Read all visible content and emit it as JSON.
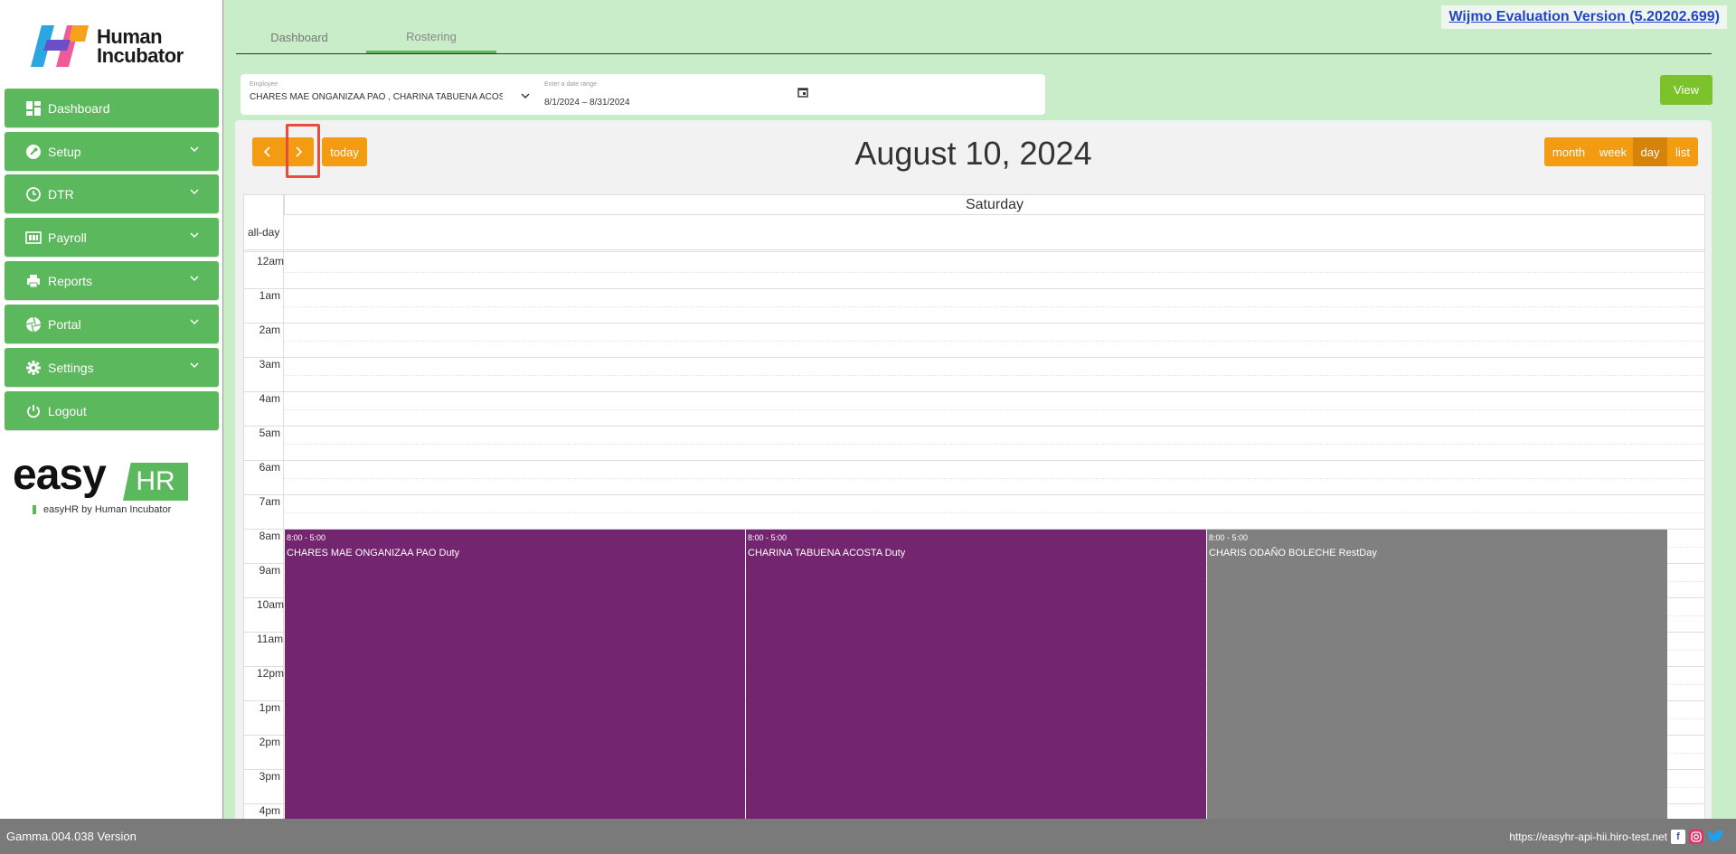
{
  "brand": {
    "line1": "Human",
    "line2": "Incubator"
  },
  "sidebar": {
    "items": [
      {
        "label": "Dashboard",
        "icon": "dashboard-icon"
      },
      {
        "label": "Setup",
        "icon": "wrench-icon"
      },
      {
        "label": "DTR",
        "icon": "clock-icon"
      },
      {
        "label": "Payroll",
        "icon": "payroll-icon"
      },
      {
        "label": "Reports",
        "icon": "printer-icon"
      },
      {
        "label": "Portal",
        "icon": "aperture-icon"
      },
      {
        "label": "Settings",
        "icon": "gear-icon"
      },
      {
        "label": "Logout",
        "icon": "power-icon"
      }
    ]
  },
  "easyhr": {
    "word": "easy",
    "box": "HR",
    "sub": "easyHR by Human Incubator"
  },
  "tabs": [
    "Dashboard",
    "Rostering"
  ],
  "wijmo": "Wijmo Evaluation Version (5.20202.699)",
  "filters": {
    "employee_label": "Employee",
    "employee_value": "CHARES MAE ONGANIZAA PAO , CHARINA TABUENA ACOSTA",
    "date_label": "Enter a date range",
    "date_value": "8/1/2024 – 8/31/2024"
  },
  "view_button": "View",
  "calendar": {
    "today_label": "today",
    "title": "August 10, 2024",
    "views": [
      "month",
      "week",
      "day",
      "list"
    ],
    "active_view": "day",
    "day_header": "Saturday",
    "allday_label": "all-day",
    "hours": [
      "12am",
      "1am",
      "2am",
      "3am",
      "4am",
      "5am",
      "6am",
      "7am",
      "8am",
      "9am",
      "10am",
      "11am",
      "12pm",
      "1pm",
      "2pm",
      "3pm",
      "4pm"
    ],
    "events": [
      {
        "time": "8:00 - 5:00",
        "title": "CHARES MAE ONGANIZAA PAO Duty",
        "color": "#74256f"
      },
      {
        "time": "8:00 - 5:00",
        "title": "CHARINA TABUENA ACOSTA Duty",
        "color": "#74256f"
      },
      {
        "time": "8:00 - 5:00",
        "title": "CHARIS ODAÑO BOLECHE RestDay",
        "color": "#808080"
      }
    ]
  },
  "footer": {
    "version": "Gamma.004.038 Version",
    "url": "https://easyhr-api-hii.hiro-test.net",
    "social": [
      "facebook-icon",
      "instagram-icon",
      "twitter-icon"
    ]
  },
  "colors": {
    "green": "#5cb85c",
    "orange": "#f39c12",
    "purple": "#74256f",
    "rest": "#808080",
    "view": "#7cc22a"
  }
}
